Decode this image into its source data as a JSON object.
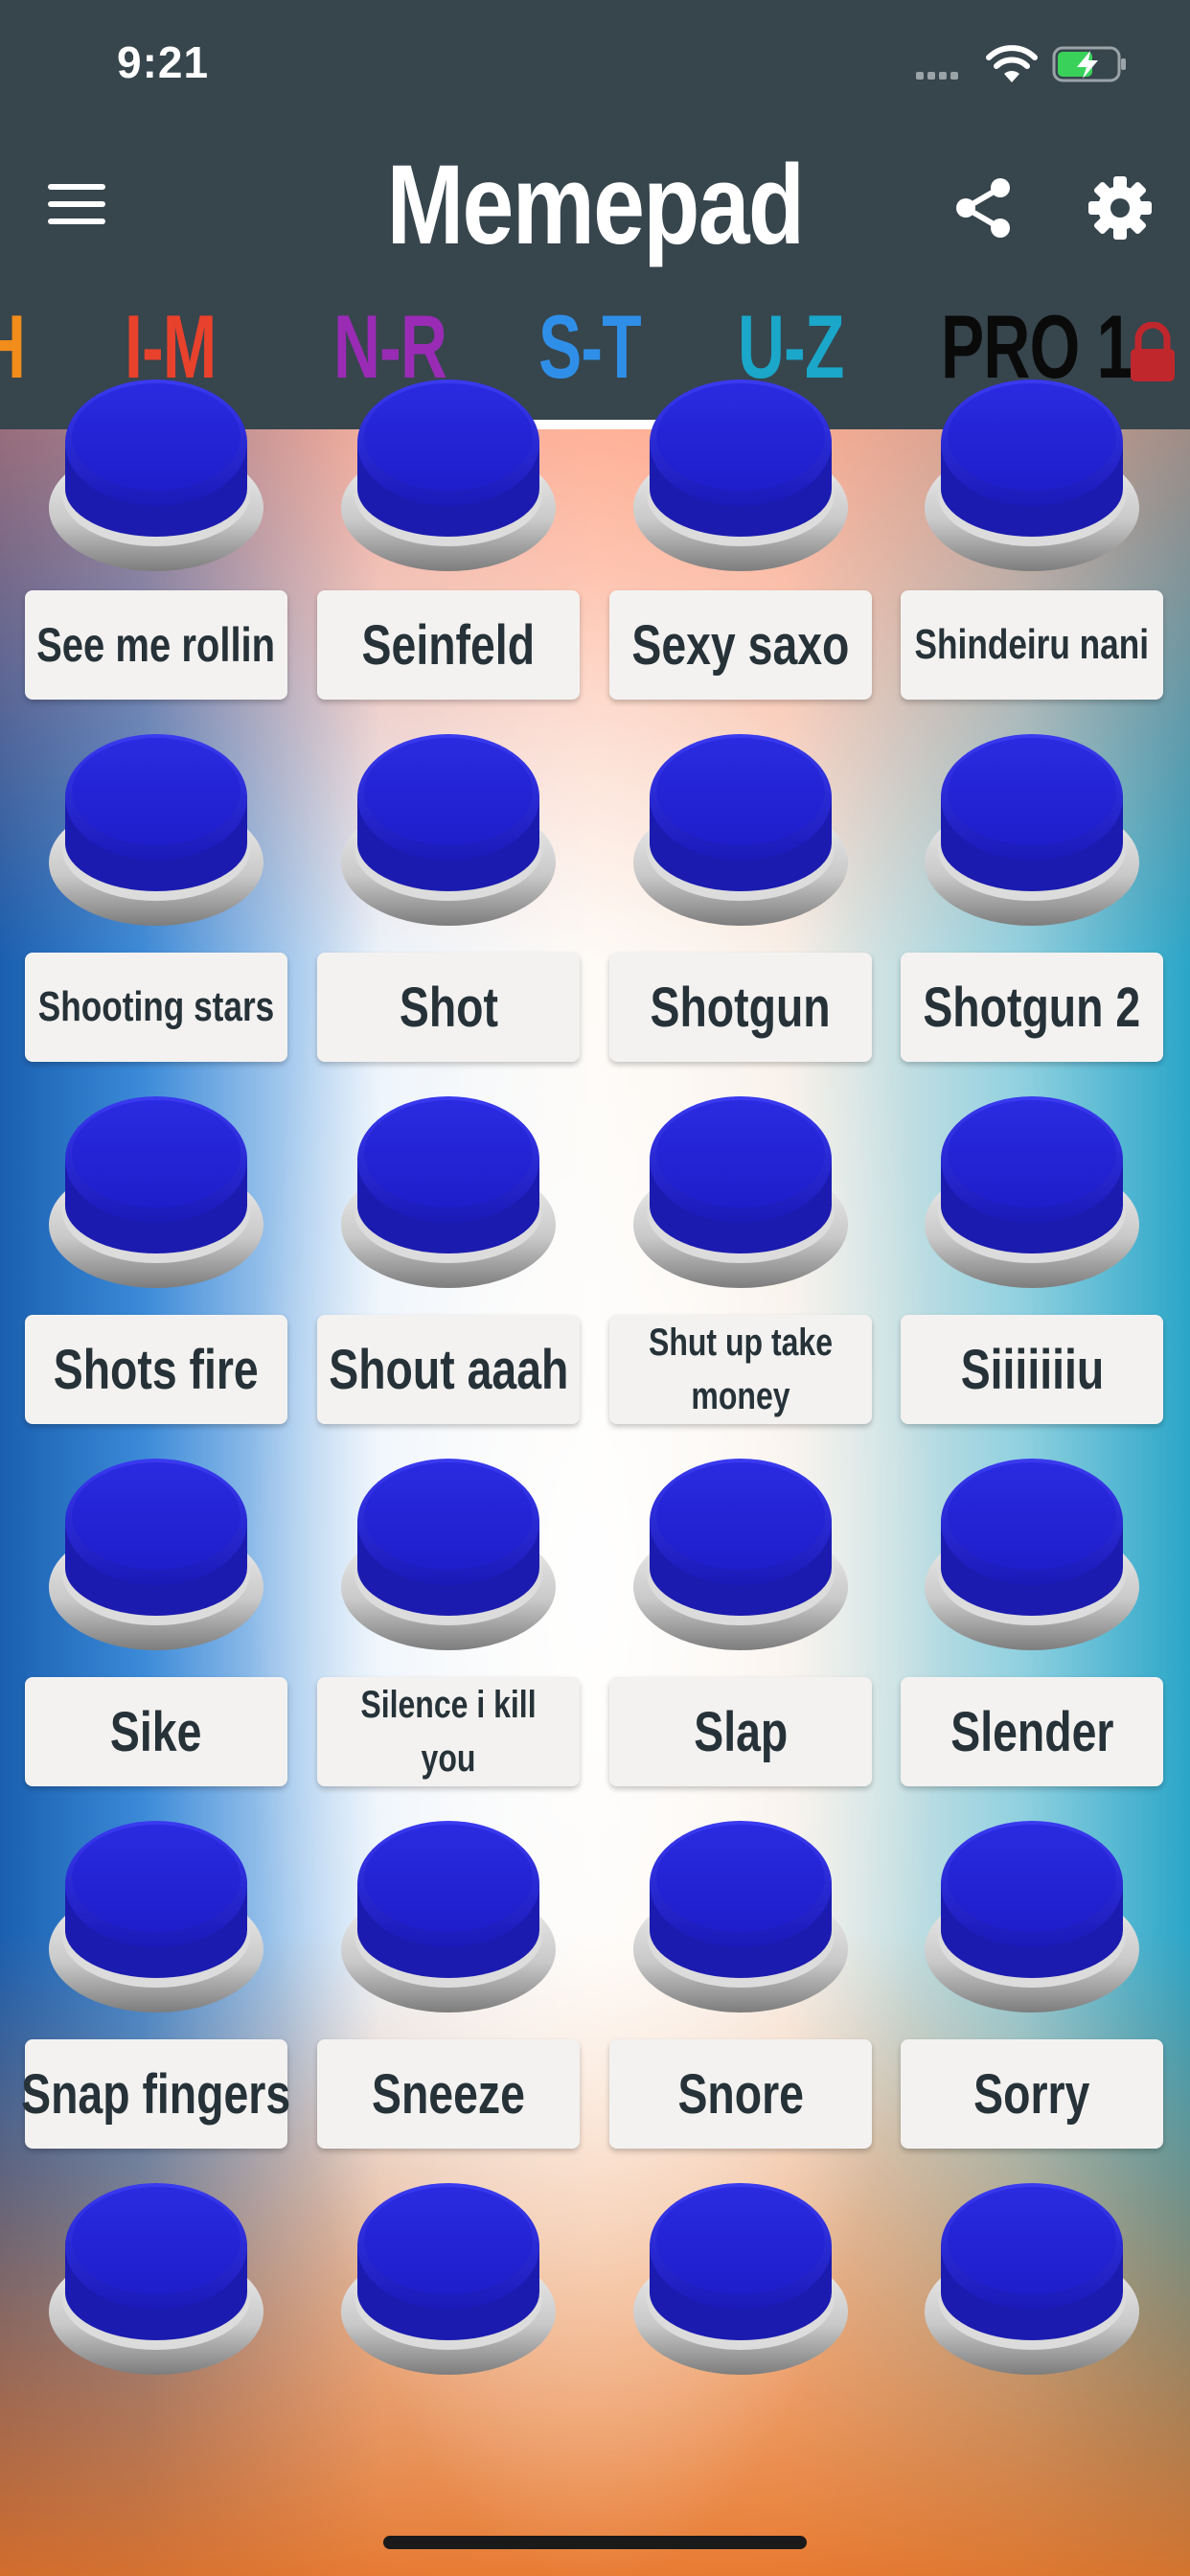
{
  "status_bar": {
    "time": "9:21"
  },
  "header": {
    "title": "Memepad"
  },
  "tabs": [
    {
      "label": "H",
      "color": "#f28c1a"
    },
    {
      "label": "I-M",
      "color": "#e8412c"
    },
    {
      "label": "N-R",
      "color": "#9a2bb5"
    },
    {
      "label": "S-T",
      "color": "#2f8fe8",
      "selected": true
    },
    {
      "label": "U-Z",
      "color": "#1aa7c9"
    },
    {
      "label": "PRO 1",
      "color": "#0a0a0a",
      "locked": true
    }
  ],
  "sounds": [
    [
      "See me rollin",
      "Seinfeld",
      "Sexy saxo",
      "Shindeiru nani"
    ],
    [
      "Shooting stars",
      "Shot",
      "Shotgun",
      "Shotgun 2"
    ],
    [
      "Shots fire",
      "Shout aaah",
      "Shut up take money",
      "Siiiiiiiu"
    ],
    [
      "Sike",
      "Silence i kill you",
      "Slap",
      "Slender"
    ],
    [
      "Snap fingers",
      "Sneeze",
      "Snore",
      "Sorry"
    ]
  ],
  "colors": {
    "header_bg": "#37454d",
    "button_blue": "#1f1fd6",
    "label_bg": "#f3f2f1",
    "label_text": "#263238",
    "lock": "#c0272d"
  },
  "icons": {
    "menu": "hamburger-menu-icon",
    "share": "share-icon",
    "settings": "gear-icon",
    "lock": "lock-icon"
  }
}
